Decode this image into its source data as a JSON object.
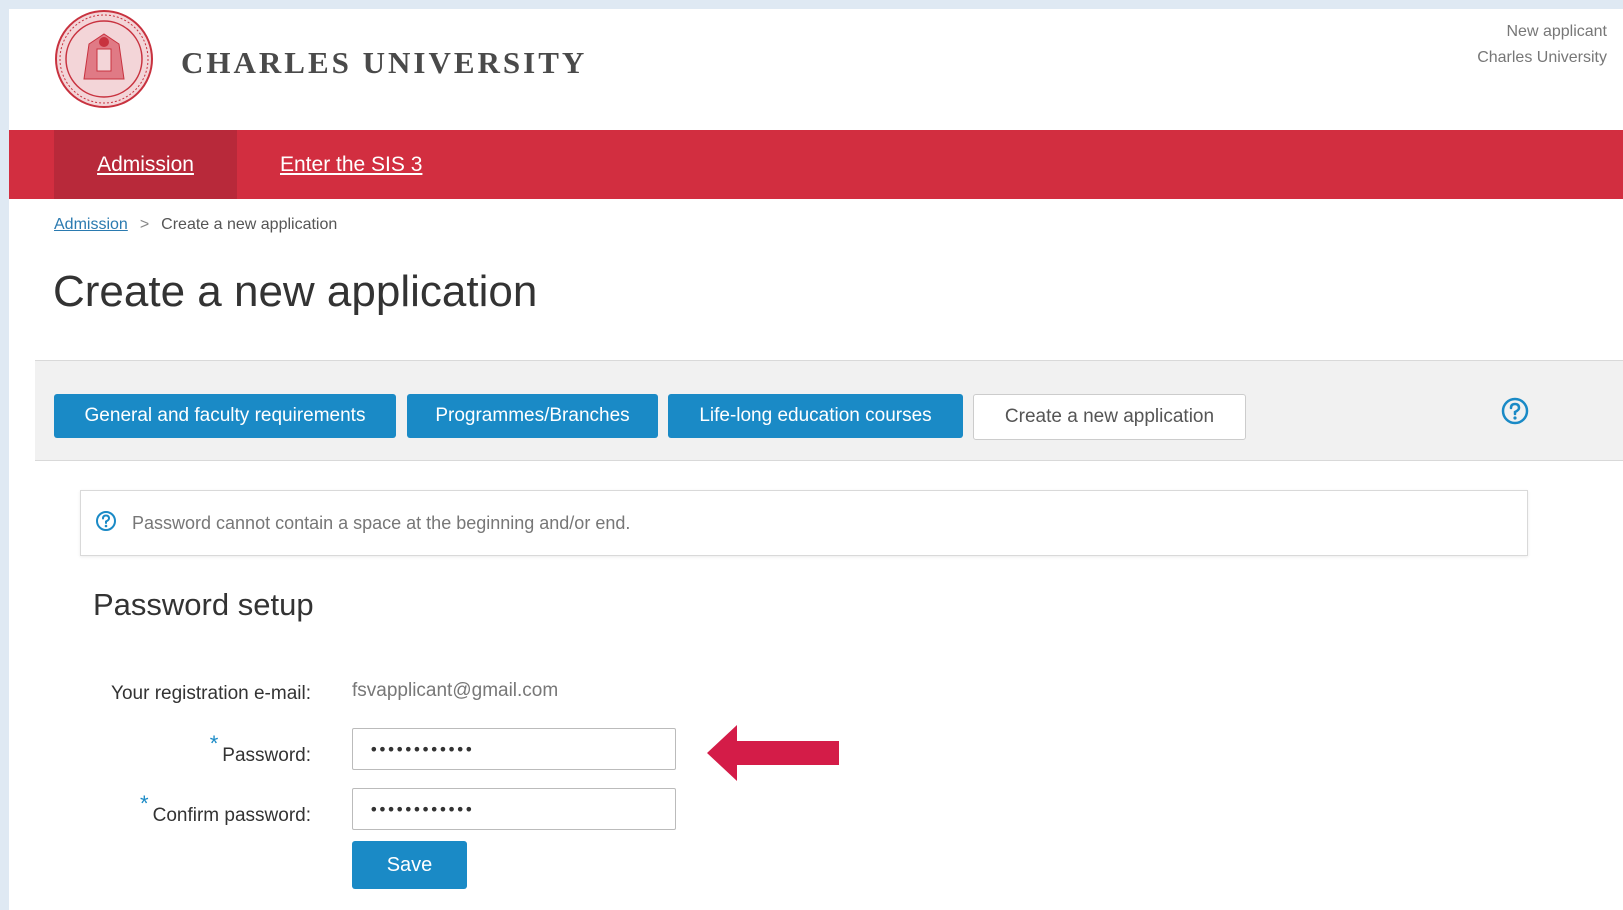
{
  "header": {
    "brand": "CHARLES UNIVERSITY",
    "user_line1": "New applicant",
    "user_line2": "Charles University"
  },
  "nav": {
    "items": [
      {
        "label": "Admission",
        "active": true
      },
      {
        "label": "Enter the SIS 3",
        "active": false
      }
    ]
  },
  "breadcrumb": {
    "root": "Admission",
    "separator": ">",
    "current": "Create a new application"
  },
  "page_title": "Create a new application",
  "tabs": [
    {
      "label": "General and faculty requirements",
      "active": false
    },
    {
      "label": "Programmes/Branches",
      "active": false
    },
    {
      "label": "Life-long education courses",
      "active": false
    },
    {
      "label": "Create a new application",
      "active": true
    }
  ],
  "info": {
    "text": "Password cannot contain a space at the beginning and/or end."
  },
  "section_title": "Password setup",
  "form": {
    "email_label": "Your registration e-mail:",
    "email_value": "fsvapplicant@gmail.com",
    "required_marker": "*",
    "password_label": "Password:",
    "password_value": "••••••••••••",
    "confirm_label": "Confirm password:",
    "confirm_value": "••••••••••••",
    "save_label": "Save"
  },
  "colors": {
    "nav_red": "#d22e40",
    "nav_active": "#b8293a",
    "tab_blue": "#1a8ac6",
    "arrow": "#d41c48"
  },
  "icons": [
    "university-seal-logo",
    "help-circle-icon",
    "info-circle-icon",
    "red-arrow-left-icon"
  ]
}
